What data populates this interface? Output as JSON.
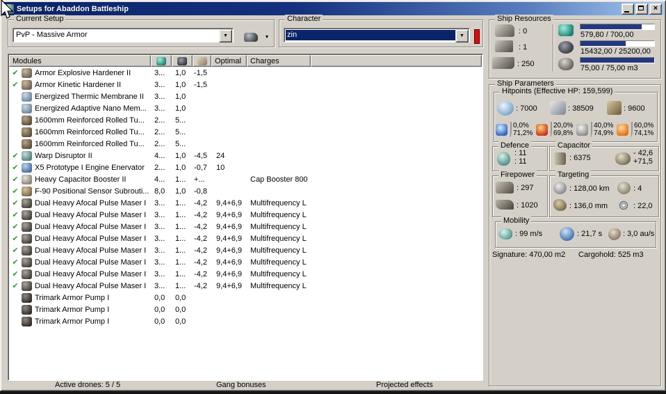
{
  "window": {
    "title": "Setups for Abaddon Battleship",
    "controls": {
      "minimize": "minimize",
      "maximize": "maximize",
      "close": "×"
    }
  },
  "current_setup": {
    "label": "Current Setup",
    "value": "PvP - Massive Armor",
    "tool_icon": "turret-tool-icon",
    "dropdown_icon": "chevron-down-icon"
  },
  "character": {
    "label": "Character",
    "value": "zin",
    "indicator_color": "#dd0a0a"
  },
  "ship_resources": {
    "label": "Ship Resources",
    "slots": [
      {
        "icon": "turret-hardpoint-icon",
        "value": ": 0"
      },
      {
        "icon": "launcher-hardpoint-icon",
        "value": ": 1"
      },
      {
        "icon": "rig-calibration-icon",
        "value": ": 250"
      }
    ],
    "bars": [
      {
        "icon": "cpu-icon",
        "text": "579,80 / 700,00",
        "pct": 82.8
      },
      {
        "icon": "powergrid-icon",
        "text": "15432,00 / 25200,00",
        "pct": 61.2
      },
      {
        "icon": "dronebay-icon",
        "text": "75,00 / 75,00 m3",
        "pct": 100
      }
    ],
    "bar_fill_color": "#24387e"
  },
  "modules": {
    "columns": {
      "modules": "Modules",
      "optimal": "Optimal",
      "charges": "Charges"
    },
    "header_icons": [
      "cpu-icon",
      "powergrid-icon",
      "capacitor-icon"
    ],
    "rows": [
      {
        "active": true,
        "icon": "armor-hardener-icon",
        "name": "Armor Explosive Hardener II",
        "cpu": "3...",
        "pg": "1,0",
        "cap": "-1,5",
        "optimal": "",
        "charges": ""
      },
      {
        "active": true,
        "icon": "armor-hardener-icon",
        "name": "Armor Kinetic Hardener II",
        "cpu": "3...",
        "pg": "1,0",
        "cap": "-1,5",
        "optimal": "",
        "charges": ""
      },
      {
        "active": false,
        "icon": "energized-membrane-icon",
        "name": "Energized Thermic Membrane II",
        "cpu": "3...",
        "pg": "1,0",
        "cap": "",
        "optimal": "",
        "charges": ""
      },
      {
        "active": false,
        "icon": "energized-membrane-icon",
        "name": "Energized Adaptive Nano Mem...",
        "cpu": "3...",
        "pg": "1,0",
        "cap": "",
        "optimal": "",
        "charges": ""
      },
      {
        "active": false,
        "icon": "armor-plate-icon",
        "name": "1600mm Reinforced Rolled Tu...",
        "cpu": "2...",
        "pg": "5...",
        "cap": "",
        "optimal": "",
        "charges": ""
      },
      {
        "active": false,
        "icon": "armor-plate-icon",
        "name": "1600mm Reinforced Rolled Tu...",
        "cpu": "2...",
        "pg": "5...",
        "cap": "",
        "optimal": "",
        "charges": ""
      },
      {
        "active": false,
        "icon": "armor-plate-icon",
        "name": "1600mm Reinforced Rolled Tu...",
        "cpu": "2...",
        "pg": "5...",
        "cap": "",
        "optimal": "",
        "charges": ""
      },
      {
        "active": true,
        "icon": "warp-disruptor-icon",
        "name": "Warp Disruptor II",
        "cpu": "4...",
        "pg": "1,0",
        "cap": "-4,5",
        "optimal": "24",
        "charges": ""
      },
      {
        "active": true,
        "icon": "stasis-web-icon",
        "name": "X5 Prototype I Engine Enervator",
        "cpu": "2...",
        "pg": "1,0",
        "cap": "-0,7",
        "optimal": "10",
        "charges": ""
      },
      {
        "active": true,
        "icon": "cap-booster-icon",
        "name": "Heavy Capacitor Booster II",
        "cpu": "4...",
        "pg": "1...",
        "cap": "+...",
        "optimal": "",
        "charges": "Cap Booster 800"
      },
      {
        "active": true,
        "icon": "sensor-booster-icon",
        "name": "F-90 Positional Sensor Subrouti...",
        "cpu": "8,0",
        "pg": "1,0",
        "cap": "-0,8",
        "optimal": "",
        "charges": ""
      },
      {
        "active": true,
        "icon": "pulse-laser-icon",
        "name": "Dual Heavy Afocal Pulse Maser I",
        "cpu": "3...",
        "pg": "1...",
        "cap": "-4,2",
        "optimal": "9,4+6,9",
        "charges": "Multifrequency L"
      },
      {
        "active": true,
        "icon": "pulse-laser-icon",
        "name": "Dual Heavy Afocal Pulse Maser I",
        "cpu": "3...",
        "pg": "1...",
        "cap": "-4,2",
        "optimal": "9,4+6,9",
        "charges": "Multifrequency L"
      },
      {
        "active": true,
        "icon": "pulse-laser-icon",
        "name": "Dual Heavy Afocal Pulse Maser I",
        "cpu": "3...",
        "pg": "1...",
        "cap": "-4,2",
        "optimal": "9,4+6,9",
        "charges": "Multifrequency L"
      },
      {
        "active": true,
        "icon": "pulse-laser-icon",
        "name": "Dual Heavy Afocal Pulse Maser I",
        "cpu": "3...",
        "pg": "1...",
        "cap": "-4,2",
        "optimal": "9,4+6,9",
        "charges": "Multifrequency L"
      },
      {
        "active": true,
        "icon": "pulse-laser-icon",
        "name": "Dual Heavy Afocal Pulse Maser I",
        "cpu": "3...",
        "pg": "1...",
        "cap": "-4,2",
        "optimal": "9,4+6,9",
        "charges": "Multifrequency L"
      },
      {
        "active": true,
        "icon": "pulse-laser-icon",
        "name": "Dual Heavy Afocal Pulse Maser I",
        "cpu": "3...",
        "pg": "1...",
        "cap": "-4,2",
        "optimal": "9,4+6,9",
        "charges": "Multifrequency L"
      },
      {
        "active": true,
        "icon": "pulse-laser-icon",
        "name": "Dual Heavy Afocal Pulse Maser I",
        "cpu": "3...",
        "pg": "1...",
        "cap": "-4,2",
        "optimal": "9,4+6,9",
        "charges": "Multifrequency L"
      },
      {
        "active": true,
        "icon": "pulse-laser-icon",
        "name": "Dual Heavy Afocal Pulse Maser I",
        "cpu": "3...",
        "pg": "1...",
        "cap": "-4,2",
        "optimal": "9,4+6,9",
        "charges": "Multifrequency L"
      },
      {
        "active": false,
        "icon": "rig-icon",
        "name": "Trimark Armor Pump I",
        "cpu": "0,0",
        "pg": "0,0",
        "cap": "",
        "optimal": "",
        "charges": ""
      },
      {
        "active": false,
        "icon": "rig-icon",
        "name": "Trimark Armor Pump I",
        "cpu": "0,0",
        "pg": "0,0",
        "cap": "",
        "optimal": "",
        "charges": ""
      },
      {
        "active": false,
        "icon": "rig-icon",
        "name": "Trimark Armor Pump I",
        "cpu": "0,0",
        "pg": "0,0",
        "cap": "",
        "optimal": "",
        "charges": ""
      }
    ]
  },
  "ship_parameters": {
    "label": "Ship Parameters",
    "hitpoints": {
      "label": "Hitpoints (Effective HP: 159,599)",
      "values": [
        {
          "icon": "shield-icon",
          "value": ": 7000"
        },
        {
          "icon": "armor-icon",
          "value": ": 38509"
        },
        {
          "icon": "structure-icon",
          "value": ": 9600"
        }
      ],
      "resists": [
        {
          "icon": "em-icon",
          "shield": "0,0%",
          "armor": "71,2%"
        },
        {
          "icon": "thermal-icon",
          "shield": "20,0%",
          "armor": "69,8%"
        },
        {
          "icon": "kinetic-icon",
          "shield": "40,0%",
          "armor": "74,9%"
        },
        {
          "icon": "explosive-icon",
          "shield": "60,0%",
          "armor": "74,1%"
        }
      ]
    },
    "defence": {
      "label": "Defence",
      "line1": ": 11",
      "line2": ": 11"
    },
    "capacitor": {
      "label": "Capacitor",
      "amount": ": 6375",
      "delta_minus": "- 42,6",
      "delta_plus": "+71,5"
    },
    "firepower": {
      "label": "Firepower",
      "dps": ": 297",
      "volley": ": 1020"
    },
    "targeting": {
      "label": "Targeting",
      "range": ": 128,00 km",
      "max_targets": ": 4",
      "scan_res": ": 136,0 mm",
      "sensor_strength": ": 22,0"
    },
    "mobility": {
      "label": "Mobility",
      "speed": ": 99 m/s",
      "align_time": ": 21,7 s",
      "warp_speed": ": 3,0 au/s"
    },
    "signature": "Signature: 470,00 m2",
    "cargohold": "Cargohold: 525 m3"
  },
  "bottom_tabs": [
    {
      "label": "Active drones: 5 / 5"
    },
    {
      "label": "Gang bonuses"
    },
    {
      "label": "Projected effects"
    }
  ],
  "colors": {
    "titlebar_start": "#0a246a",
    "titlebar_end": "#a6caf0",
    "window_bg": "#d4d0c8",
    "bar_fill": "#24387e",
    "active_check": "#2f9e2f",
    "red_indicator": "#dd0a0a"
  }
}
